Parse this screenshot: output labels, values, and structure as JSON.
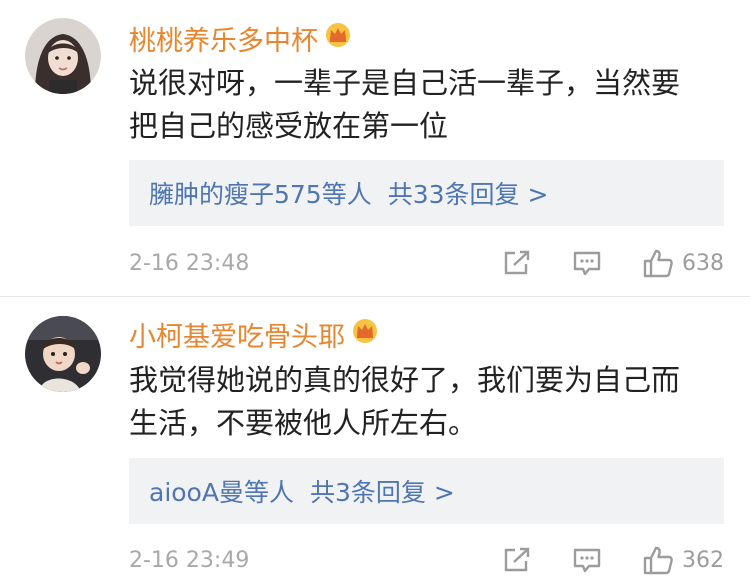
{
  "comments": [
    {
      "username": "桃桃养乐多中杯",
      "text_line1": "说很对呀，一辈子是自己活一辈子，当然要",
      "text_line2": "把自己的感受放在第一位",
      "reply_users": "臃肿的瘦子575等人",
      "reply_count": "共33条回复 >",
      "time": "2-16 23:48",
      "likes": "638"
    },
    {
      "username": "小柯基爱吃骨头耶",
      "text_line1": "我觉得她说的真的很好了，我们要为自己而",
      "text_line2": "生活，不要被他人所左右。",
      "reply_users": "aiooA曼等人",
      "reply_count": "共3条回复 >",
      "time": "2-16 23:49",
      "likes": "362"
    }
  ],
  "colors": {
    "username": "#e8862f",
    "link": "#4f75b2",
    "meta": "#a9a9a9",
    "reply_bg": "#f1f2f4"
  },
  "icons": [
    "crown-badge-icon",
    "share-icon",
    "comment-icon",
    "like-icon"
  ]
}
